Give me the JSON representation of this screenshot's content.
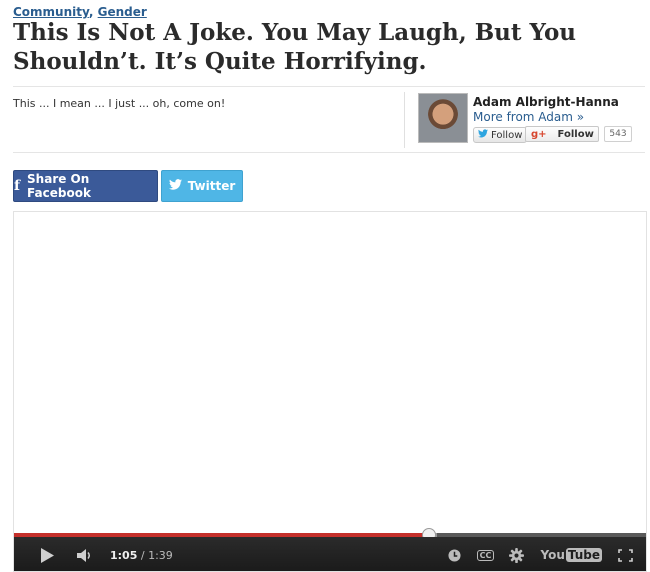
{
  "article": {
    "categories": [
      "Community",
      "Gender"
    ],
    "category_separator": ", ",
    "title": "This Is Not A Joke. You May Laugh, But You Shouldn’t. It’s Quite Horrifying.",
    "excerpt": "This ... I mean ... I just ... oh, come on!"
  },
  "author": {
    "name": "Adam Albright-Hanna",
    "more_link": "More from Adam »",
    "twitter_follow_label": "Follow",
    "google_follow_label": "Follow",
    "google_follow_count": "543"
  },
  "share": {
    "facebook_label": "Share On Facebook",
    "twitter_label": "Twitter"
  },
  "video": {
    "current_time": "1:05",
    "time_separator": " / ",
    "duration": "1:39",
    "progress": 0.656,
    "buffered": 0.67,
    "brand_you": "You",
    "brand_tube": "Tube",
    "cc_label": "CC"
  },
  "colors": {
    "link": "#2a5d8f",
    "facebook": "#3b5a99",
    "twitter": "#4fb6e6",
    "progress": "#c4302b"
  },
  "icons": {
    "play": "play-icon",
    "volume": "volume-icon",
    "clock": "watch-later-icon",
    "captions": "captions-icon",
    "settings": "gear-icon",
    "fullscreen": "fullscreen-icon"
  }
}
